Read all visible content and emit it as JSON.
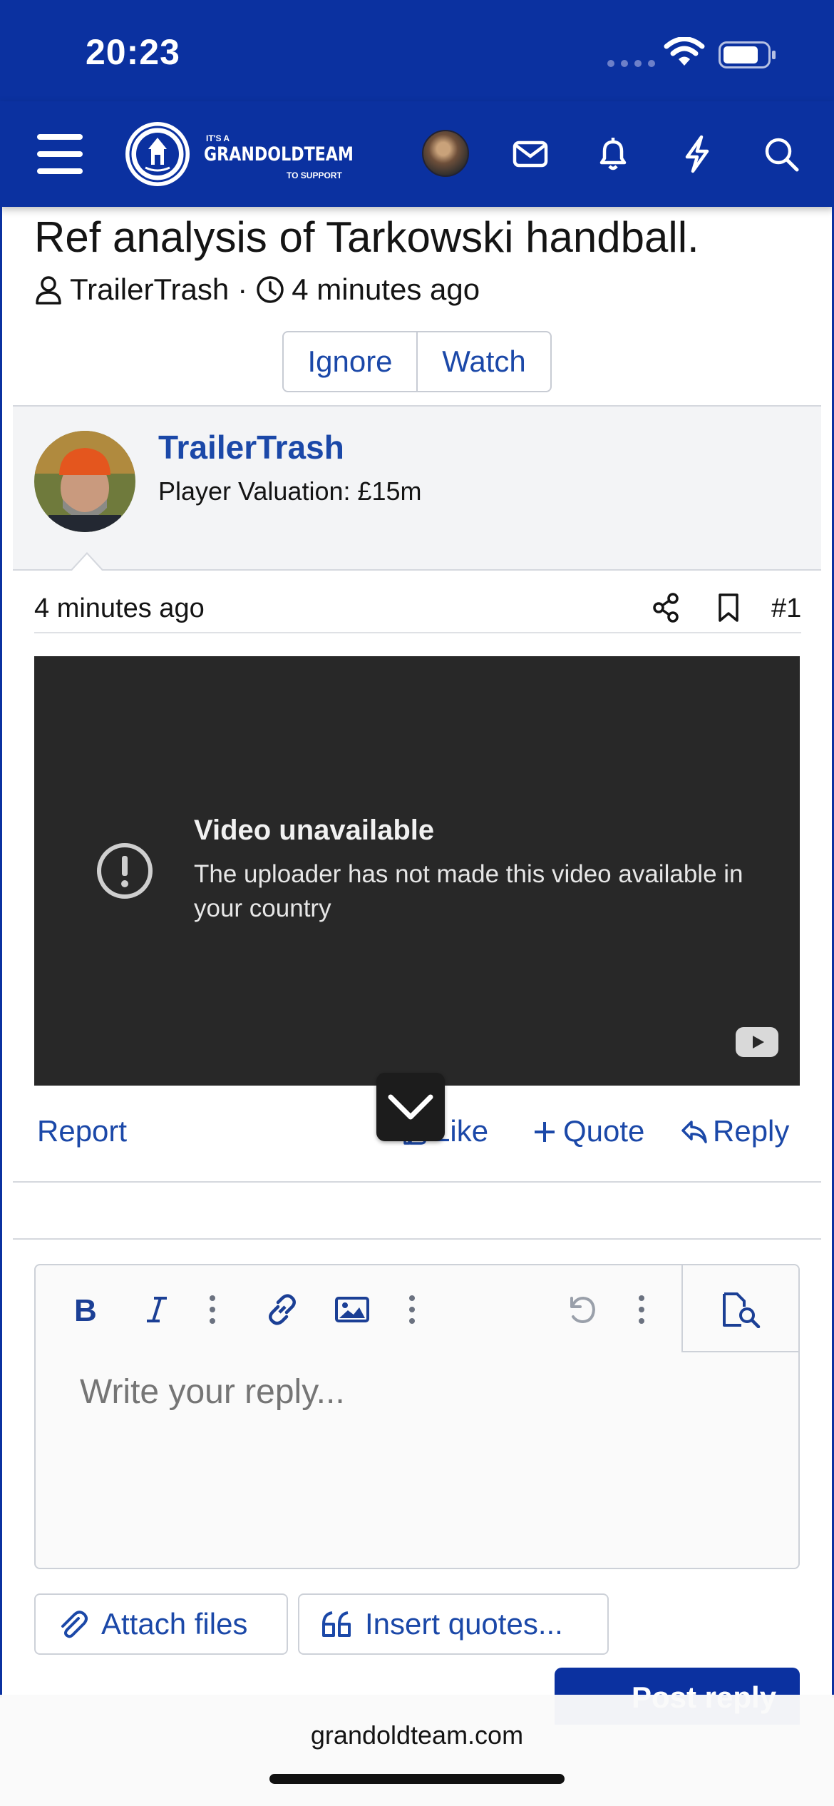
{
  "status_bar": {
    "time": "20:23"
  },
  "header": {
    "logo": {
      "top_text": "IT'S A",
      "name": "GRANDOLDTEAM",
      "bottom_text": "TO SUPPORT"
    },
    "icons": [
      "menu-icon",
      "avatar",
      "mail-icon",
      "bell-icon",
      "lightning-icon",
      "search-icon"
    ]
  },
  "thread": {
    "title": "Ref analysis of Tarkowski handball.",
    "author": "TrailerTrash",
    "separator": "·",
    "time": "4 minutes ago",
    "buttons": {
      "ignore": "Ignore",
      "watch": "Watch"
    }
  },
  "post": {
    "author_name": "TrailerTrash",
    "author_title": "Player Valuation: £15m",
    "time": "4 minutes ago",
    "number": "#1",
    "video": {
      "heading": "Video unavailable",
      "message": "The uploader has not made this video available in your country"
    },
    "actions": {
      "report": "Report",
      "like": "Like",
      "quote": "Quote",
      "reply": "Reply"
    }
  },
  "editor": {
    "placeholder": "Write your reply...",
    "attach_label": "Attach files",
    "insert_quotes_label": "Insert quotes...",
    "post_reply_label": "Post reply"
  },
  "browser": {
    "url": "grandoldteam.com"
  },
  "colors": {
    "brand": "#0b31a0",
    "link": "#1b48a8",
    "video_bg": "#282828"
  }
}
